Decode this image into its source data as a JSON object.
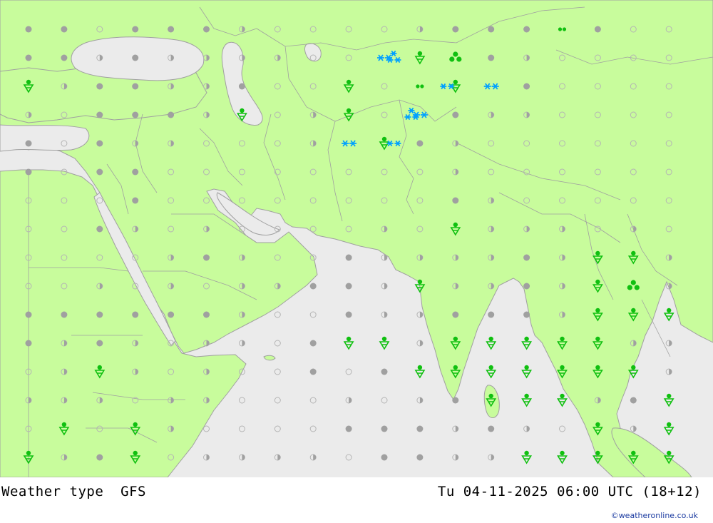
{
  "title": {
    "product": "Weather type",
    "model": "GFS",
    "valid": "Tu 04-11-2025 06:00 UTC (18+12)"
  },
  "credit": "©weatheronline.co.uk",
  "colors": {
    "land": "#c8fc9c",
    "sea": "#ebebeb",
    "border": "#a0a0a0",
    "dot_fill": "#a0a0a0",
    "dot_ring": "#b4b4b4",
    "rain": "#10c010",
    "snow": "#00a0ff"
  },
  "grid": {
    "cols": 19,
    "rows": 16,
    "legend": "o = no weather (ring), h = half-filled, f = filled (cloud), r = rain shower, s = snow, d = drizzle, c = cluster rain",
    "cells": [
      "ffofffhoooohfffdfoo",
      "ffhfhhhhoosrcfhoooo",
      "rhffhhfoorodrsfoooo",
      "hofffhrohrosfhhoooo",
      "fofhhooohsrfhoooooo",
      "foffoooooooohoooooo",
      "ooofoooooooofhooooo",
      "oofhohoooohorhhhoho",
      "oooohfhoofhhhhfhrrh",
      "oohohohhffhrhhfhrch",
      "ffffffhoofhhfffhrrr",
      "fhfhohhofrrhrrrrrhh",
      "ohrhohoofofrrrrrrrh",
      "hhhohhooohohfrrrhfr",
      "ororhoooofffhfhorhr",
      "rhfrohhhhoffhhrrrrr"
    ],
    "snow_positions": [
      {
        "col": 10.5,
        "row": 1.0,
        "kind": "triple"
      },
      {
        "col": 12.0,
        "row": 2.0,
        "kind": "double"
      },
      {
        "col": 10.5,
        "row": 4.0,
        "kind": "double"
      },
      {
        "col": 11.0,
        "row": 3.0,
        "kind": "triple"
      }
    ]
  }
}
